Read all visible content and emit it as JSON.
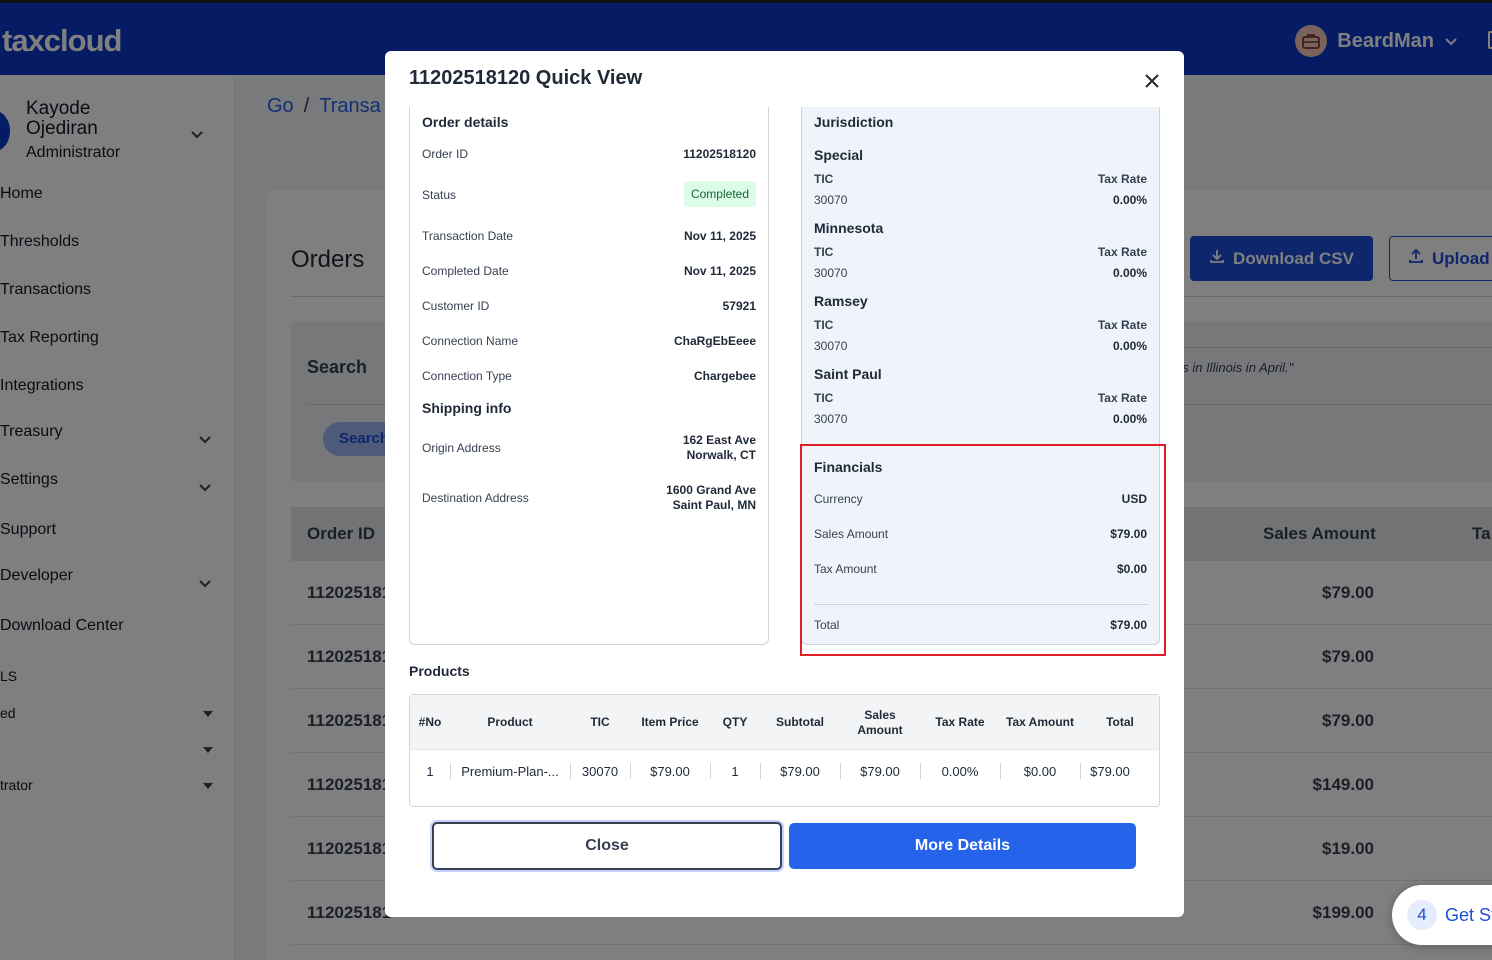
{
  "app": {
    "logo": "taxcloud"
  },
  "header": {
    "user_name": "BeardMan"
  },
  "sidebar": {
    "user_name": "Kayode Ojediran",
    "role": "Administrator",
    "items": [
      {
        "label": "Home"
      },
      {
        "label": "Thresholds"
      },
      {
        "label": "Transactions"
      },
      {
        "label": "Tax Reporting"
      },
      {
        "label": "Integrations"
      },
      {
        "label": "Treasury"
      },
      {
        "label": "Settings"
      },
      {
        "label": "Support"
      },
      {
        "label": "Developer"
      },
      {
        "label": "Download Center"
      },
      {
        "label": "LS"
      },
      {
        "label": "ed"
      },
      {
        "label": ""
      },
      {
        "label": "trator"
      }
    ]
  },
  "page": {
    "breadcrumb": [
      "Go",
      "Transa"
    ],
    "title": "Orders",
    "download_csv_label": "Download CSV",
    "upload_label": "Upload",
    "search_label": "Search",
    "search_button": "Search",
    "search_hint": "es in Illinois in April.\"",
    "table_headers": {
      "order_id": "Order ID",
      "sales_amount": "Sales Amount",
      "tax": "Ta"
    },
    "rows": [
      {
        "order_id": "112025181",
        "sales_amount": "$79.00"
      },
      {
        "order_id": "112025181",
        "sales_amount": "$79.00"
      },
      {
        "order_id": "112025181",
        "sales_amount": "$79.00"
      },
      {
        "order_id": "112025181",
        "sales_amount": "$149.00"
      },
      {
        "order_id": "112025181",
        "sales_amount": "$19.00"
      },
      {
        "order_id": "112025181",
        "sales_amount": "$199.00"
      }
    ]
  },
  "get_started": {
    "count": "4",
    "label": "Get St"
  },
  "modal": {
    "title": "11202518120 Quick View",
    "order_details": {
      "title": "Order details",
      "order_id_label": "Order ID",
      "order_id": "11202518120",
      "status_label": "Status",
      "status": "Completed",
      "transaction_date_label": "Transaction Date",
      "transaction_date": "Nov 11, 2025",
      "completed_date_label": "Completed Date",
      "completed_date": "Nov 11, 2025",
      "customer_id_label": "Customer ID",
      "customer_id": "57921",
      "connection_name_label": "Connection Name",
      "connection_name": "ChaRgEbEeee",
      "connection_type_label": "Connection Type",
      "connection_type": "Chargebee"
    },
    "shipping": {
      "title": "Shipping info",
      "origin_label": "Origin Address",
      "origin_line1": "162 East Ave",
      "origin_line2": "Norwalk, CT",
      "destination_label": "Destination Address",
      "destination_line1": "1600 Grand Ave",
      "destination_line2": "Saint Paul, MN"
    },
    "jurisdiction": {
      "title": "Jurisdiction",
      "tic_label": "TIC",
      "rate_label": "Tax Rate",
      "items": [
        {
          "name": "Special",
          "tic": "30070",
          "rate": "0.00%"
        },
        {
          "name": "Minnesota",
          "tic": "30070",
          "rate": "0.00%"
        },
        {
          "name": "Ramsey",
          "tic": "30070",
          "rate": "0.00%"
        },
        {
          "name": "Saint Paul",
          "tic": "30070",
          "rate": "0.00%"
        }
      ]
    },
    "financials": {
      "title": "Financials",
      "currency_label": "Currency",
      "currency": "USD",
      "sales_label": "Sales Amount",
      "sales": "$79.00",
      "tax_label": "Tax Amount",
      "tax": "$0.00",
      "total_label": "Total",
      "total": "$79.00"
    },
    "products": {
      "title": "Products",
      "headers": [
        "#No",
        "Product",
        "TIC",
        "Item Price",
        "QTY",
        "Subtotal",
        "Sales Amount",
        "Tax Rate",
        "Tax Amount",
        "Total"
      ],
      "rows": [
        [
          "1",
          "Premium-Plan-...",
          "30070",
          "$79.00",
          "1",
          "$79.00",
          "$79.00",
          "0.00%",
          "$0.00",
          "$79.00"
        ]
      ]
    },
    "close_label": "Close",
    "more_details_label": "More Details"
  },
  "colors": {
    "brand": "#0b37c6",
    "primary_button": "#2563eb",
    "highlight": "#e11d27",
    "status_completed_bg": "#dcfce7"
  },
  "icons": [
    "briefcase-icon",
    "chevron-down-icon",
    "download-icon",
    "upload-icon",
    "close-icon",
    "caret-down-icon"
  ]
}
